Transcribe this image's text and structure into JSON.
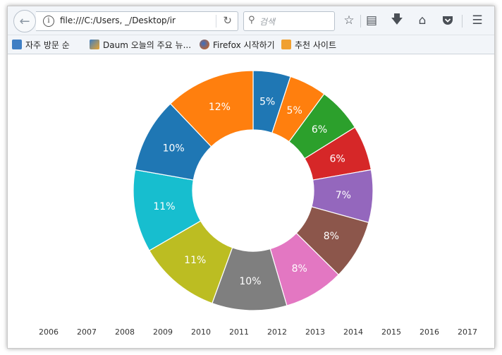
{
  "browser": {
    "url": "file:///C:/Users,             _/Desktop/ir",
    "search_placeholder": "검색",
    "icons": [
      "back-arrow-icon",
      "info-icon",
      "reload-icon",
      "search-icon",
      "star-icon",
      "reading-list-icon",
      "download-icon",
      "home-icon",
      "pocket-icon",
      "menu-icon"
    ],
    "bookmarks": [
      {
        "label": "자주 방문 순",
        "icon": "bookmark-folder-icon",
        "color": "#3f7fc4"
      },
      {
        "label": "Daum 오늘의 주요 뉴...",
        "icon": "daum-icon",
        "color": "#e8a32c"
      },
      {
        "label": "Firefox 시작하기",
        "icon": "firefox-icon",
        "color": "#e66000"
      },
      {
        "label": "추천 사이트",
        "icon": "lightbulb-icon",
        "color": "#f0a030"
      }
    ]
  },
  "chart_data": {
    "type": "pie",
    "donut": true,
    "categories": [
      "2006",
      "2007",
      "2008",
      "2009",
      "2010",
      "2011",
      "2012",
      "2013",
      "2014",
      "2015",
      "2016",
      "2017"
    ],
    "values": [
      5,
      5,
      6,
      6,
      7,
      8,
      8,
      10,
      11,
      11,
      10,
      12
    ],
    "labels": [
      "5%",
      "5%",
      "6%",
      "6%",
      "7%",
      "8%",
      "8%",
      "10%",
      "11%",
      "11%",
      "10%",
      "12%"
    ],
    "colors": [
      "#1f77b4",
      "#ff7f0e",
      "#2ca02c",
      "#d62728",
      "#9467bd",
      "#8c564b",
      "#e377c2",
      "#7f7f7f",
      "#bcbd22",
      "#17becf",
      "#1f77b4",
      "#ff7f0e"
    ],
    "legend_placement": "bottom",
    "title": ""
  }
}
